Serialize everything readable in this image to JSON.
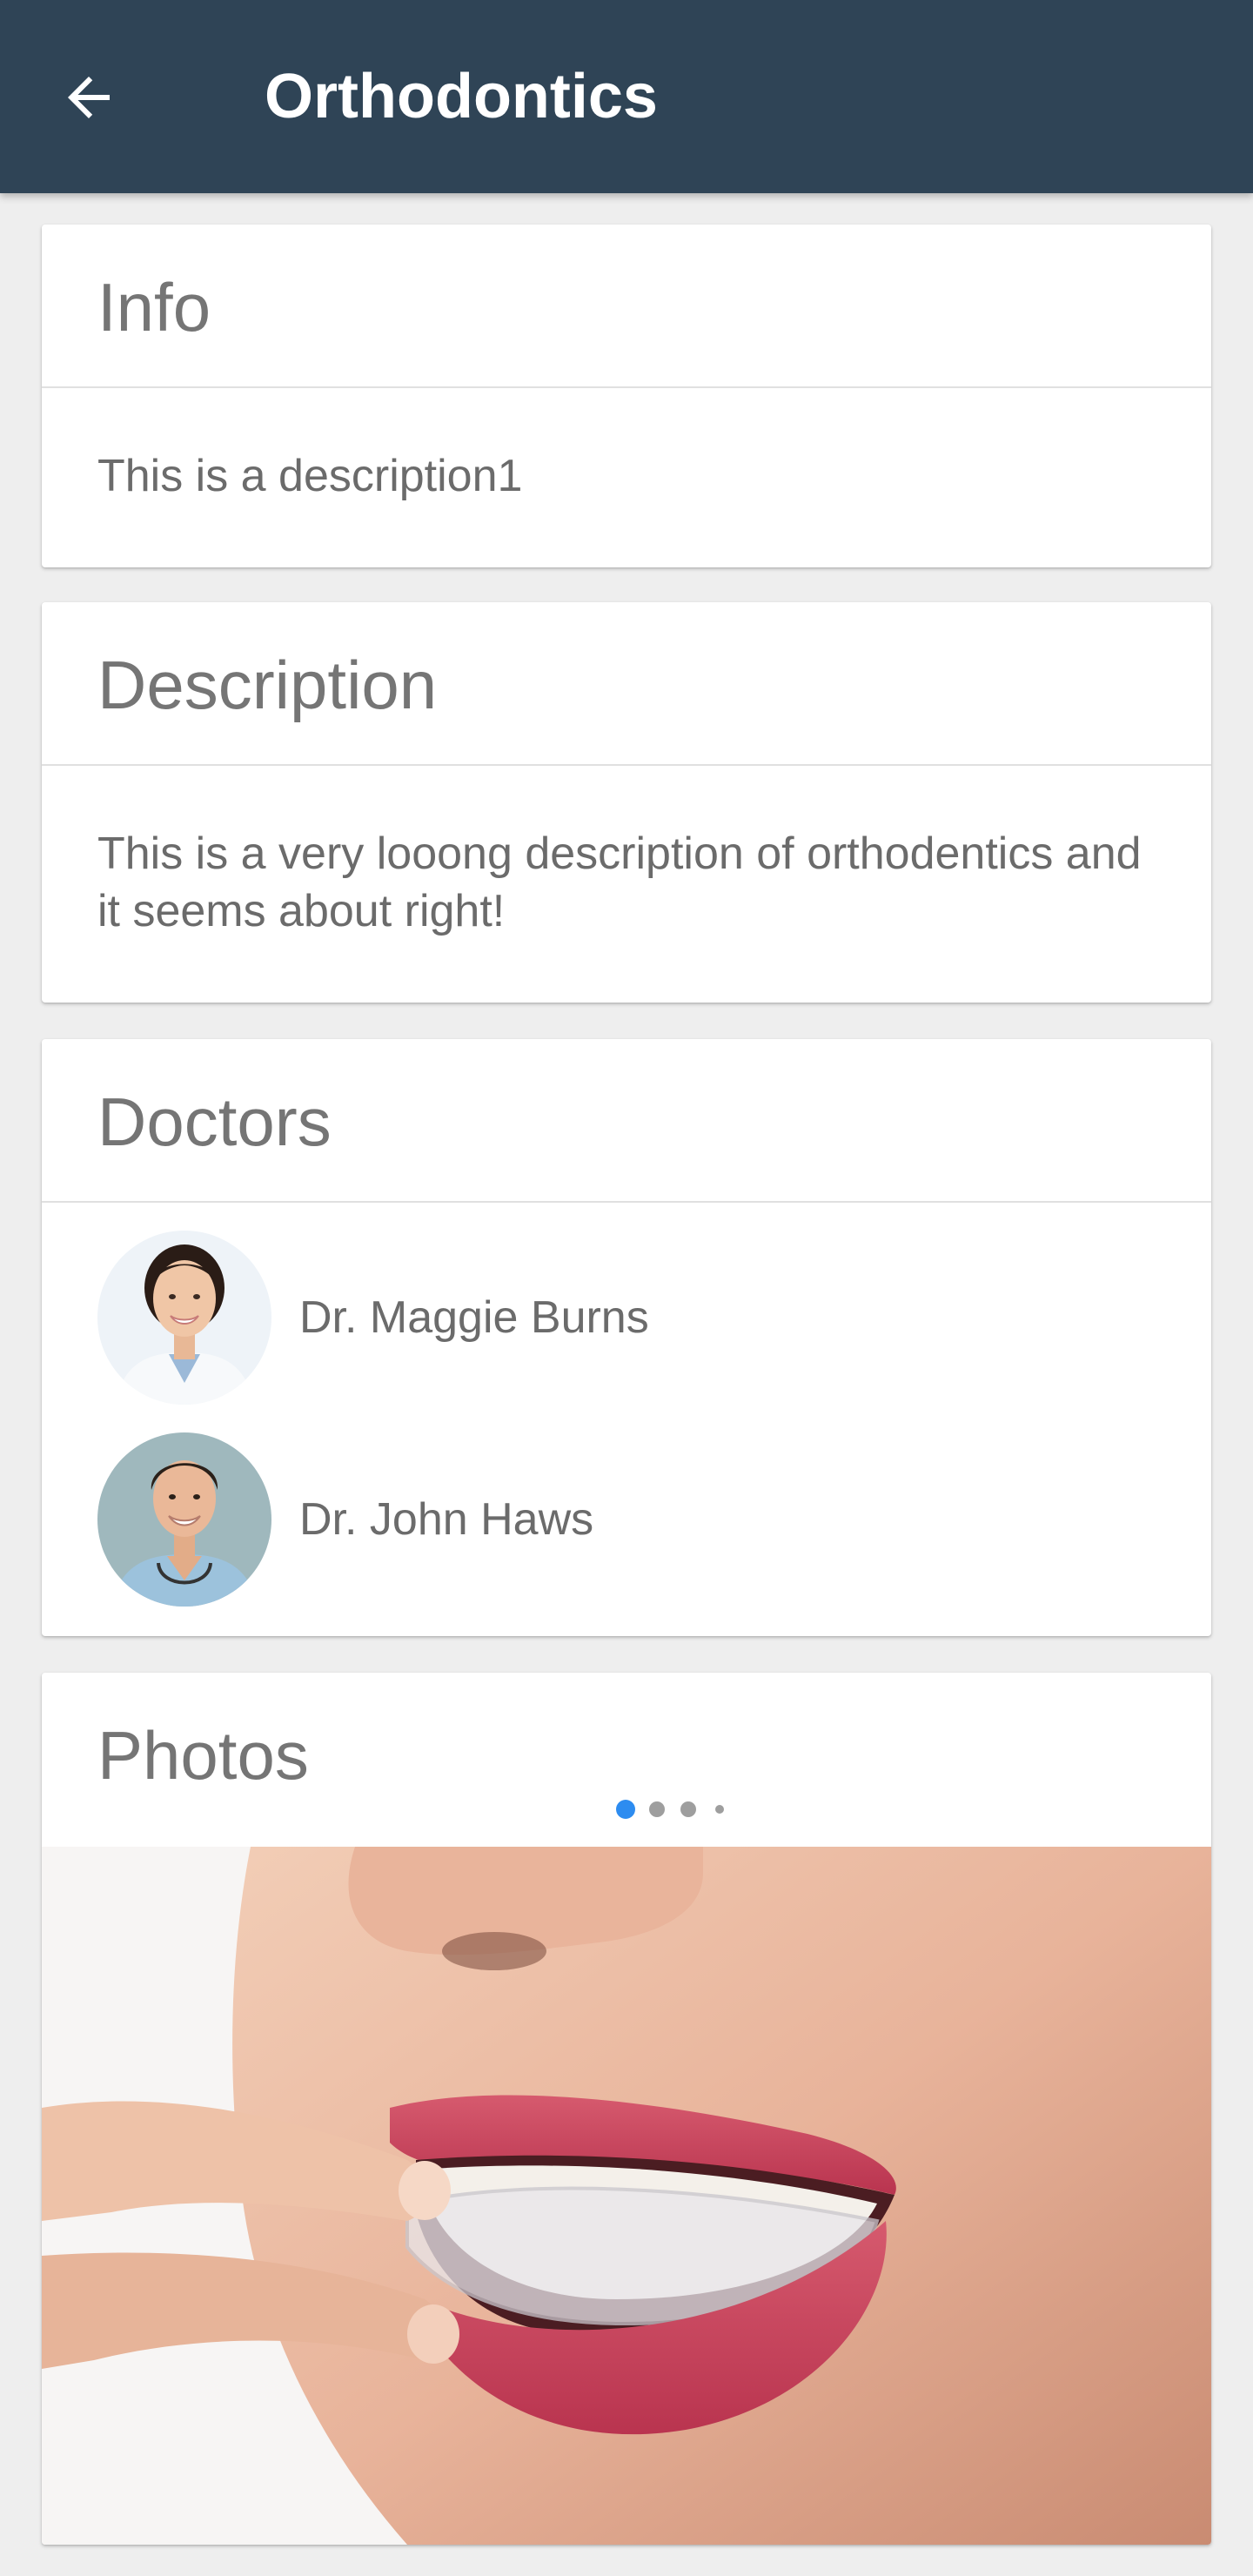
{
  "app_bar": {
    "title": "Orthodontics",
    "back_icon": "arrow-back-icon",
    "background": "#2f4456"
  },
  "info": {
    "title": "Info",
    "text": "This is a description1"
  },
  "description": {
    "title": "Description",
    "text": "This is a very looong description of orthodentics and it seems about right!"
  },
  "doctors": {
    "title": "Doctors",
    "items": [
      {
        "name": "Dr. Maggie Burns",
        "avatar": "female-doctor-avatar"
      },
      {
        "name": "Dr. John Haws",
        "avatar": "male-doctor-avatar"
      }
    ]
  },
  "photos": {
    "title": "Photos",
    "page_count": 4,
    "current_page": 1,
    "active_dot_color": "#2d8cf0",
    "image": "clear-aligner-photo"
  }
}
